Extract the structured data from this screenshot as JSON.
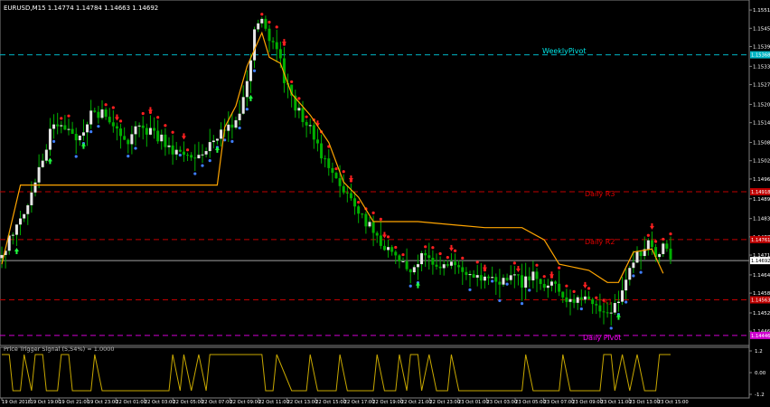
{
  "chart_data": [
    {
      "type": "candlestick",
      "title": "EURUSD,M15 1.14774 1.14784 1.14663 1.14692",
      "symbol": "EURUSD",
      "timeframe": "M15",
      "ohlc_header": {
        "open": 1.14774,
        "high": 1.14784,
        "low": 1.14663,
        "close": 1.14692
      },
      "y_axis": {
        "ticks": [
          1.15515,
          1.15455,
          1.15395,
          1.1533,
          1.1527,
          1.15205,
          1.15145,
          1.1508,
          1.1502,
          1.1496,
          1.14895,
          1.1483,
          1.1477,
          1.1471,
          1.14645,
          1.14585,
          1.1452,
          1.1446
        ],
        "ylim": [
          1.14413,
          1.15548
        ],
        "current_price_label": "1.14692",
        "current_price": 1.14692
      },
      "levels": [
        {
          "name": "WeeklyPivot",
          "label": "WeeklyPivot",
          "value": 1.15368,
          "price_label": "1.15368",
          "color": "#00b5c4",
          "label_color": "#00e5e5"
        },
        {
          "name": "Daily R3",
          "label": "Daily R3",
          "value": 1.14918,
          "price_label": "1.14918",
          "color": "#c00000",
          "label_color": "#e00000"
        },
        {
          "name": "Daily R2",
          "label": "Daily R2",
          "value": 1.14761,
          "price_label": "1.14761",
          "color": "#c00000",
          "label_color": "#e00000"
        },
        {
          "name": "Daily R1",
          "label": "R1",
          "value": 1.14563,
          "price_label": "1.14563",
          "color": "#c00000",
          "label_color": "#e00000"
        },
        {
          "name": "Daily Pivot",
          "label": "Daily Pivot",
          "value": 1.14446,
          "price_label": "1.14446",
          "color": "#d000d0",
          "label_color": "#ff00ff"
        }
      ],
      "x_axis": {
        "ticks": [
          "19 Oct 2018",
          "19 Oct 19:00",
          "19 Oct 21:00",
          "19 Oct 23:00",
          "22 Oct 01:00",
          "22 Oct 03:00",
          "22 Oct 05:00",
          "22 Oct 07:00",
          "22 Oct 09:00",
          "22 Oct 11:00",
          "22 Oct 13:00",
          "22 Oct 15:00",
          "22 Oct 17:00",
          "22 Oct 19:00",
          "22 Oct 21:00",
          "22 Oct 23:00",
          "23 Oct 01:00",
          "23 Oct 03:00",
          "23 Oct 05:00",
          "23 Oct 07:00",
          "23 Oct 09:00",
          "23 Oct 11:00",
          "23 Oct 13:00",
          "23 Oct 15:00"
        ]
      },
      "close_path": [
        [
          0,
          1.147
        ],
        [
          3,
          1.1479
        ],
        [
          6,
          1.1485
        ],
        [
          8,
          1.1492
        ],
        [
          10,
          1.1499
        ],
        [
          13,
          1.1511
        ],
        [
          16,
          1.1515
        ],
        [
          20,
          1.1508
        ],
        [
          24,
          1.1517
        ],
        [
          28,
          1.1518
        ],
        [
          31,
          1.1512
        ],
        [
          34,
          1.1507
        ],
        [
          37,
          1.1514
        ],
        [
          40,
          1.1511
        ],
        [
          43,
          1.1509
        ],
        [
          46,
          1.1504
        ],
        [
          49,
          1.1505
        ],
        [
          52,
          1.1502
        ],
        [
          55,
          1.1506
        ],
        [
          58,
          1.151
        ],
        [
          61,
          1.1513
        ],
        [
          64,
          1.1516
        ],
        [
          66,
          1.1527
        ],
        [
          68,
          1.1544
        ],
        [
          70,
          1.1547
        ],
        [
          72,
          1.1543
        ],
        [
          74,
          1.154
        ],
        [
          76,
          1.1529
        ],
        [
          78,
          1.1522
        ],
        [
          80,
          1.1518
        ],
        [
          83,
          1.1512
        ],
        [
          86,
          1.1504
        ],
        [
          89,
          1.1498
        ],
        [
          92,
          1.1492
        ],
        [
          95,
          1.1487
        ],
        [
          98,
          1.1482
        ],
        [
          101,
          1.1477
        ],
        [
          104,
          1.1472
        ],
        [
          107,
          1.1468
        ],
        [
          110,
          1.1466
        ],
        [
          113,
          1.1471
        ],
        [
          116,
          1.1469
        ],
        [
          119,
          1.1468
        ],
        [
          122,
          1.1467
        ],
        [
          125,
          1.1465
        ],
        [
          128,
          1.1465
        ],
        [
          131,
          1.1463
        ],
        [
          134,
          1.1463
        ],
        [
          137,
          1.1464
        ],
        [
          140,
          1.1462
        ],
        [
          143,
          1.1464
        ],
        [
          146,
          1.1462
        ],
        [
          149,
          1.146
        ],
        [
          152,
          1.1457
        ],
        [
          155,
          1.1456
        ],
        [
          158,
          1.1456
        ],
        [
          161,
          1.1454
        ],
        [
          164,
          1.1452
        ],
        [
          166,
          1.1456
        ],
        [
          168,
          1.1464
        ],
        [
          170,
          1.1469
        ],
        [
          172,
          1.1472
        ],
        [
          174,
          1.1476
        ],
        [
          176,
          1.147
        ],
        [
          178,
          1.1474
        ],
        [
          180,
          1.14692
        ]
      ],
      "orange_line_path": [
        [
          0,
          1.1468
        ],
        [
          5,
          1.1494
        ],
        [
          30,
          1.1494
        ],
        [
          58,
          1.1494
        ],
        [
          60,
          1.1513
        ],
        [
          63,
          1.152
        ],
        [
          66,
          1.1533
        ],
        [
          70,
          1.1544
        ],
        [
          72,
          1.1536
        ],
        [
          75,
          1.1534
        ],
        [
          78,
          1.1524
        ],
        [
          83,
          1.1517
        ],
        [
          88,
          1.1508
        ],
        [
          92,
          1.1495
        ],
        [
          96,
          1.149
        ],
        [
          100,
          1.1482
        ],
        [
          112,
          1.1482
        ],
        [
          130,
          1.148
        ],
        [
          140,
          1.148
        ],
        [
          146,
          1.1476
        ],
        [
          150,
          1.1468
        ],
        [
          158,
          1.1466
        ],
        [
          163,
          1.1462
        ],
        [
          166,
          1.1462
        ],
        [
          170,
          1.1472
        ],
        [
          175,
          1.1473
        ],
        [
          178,
          1.1465
        ]
      ]
    },
    {
      "type": "line",
      "title": "Price Trigger Signal (5,54%) = 1.0000",
      "y_axis": {
        "ticks": [
          "1.2",
          "0.00",
          "-1.2"
        ],
        "ylim": [
          -1.2,
          1.2
        ]
      },
      "color": "#c8a800",
      "series": [
        {
          "name": "Price Trigger Signal",
          "segments": [
            [
              0,
              1
            ],
            [
              2,
              1
            ],
            [
              3,
              -1
            ],
            [
              5,
              -1
            ],
            [
              6,
              1
            ],
            [
              8,
              -1
            ],
            [
              9,
              1
            ],
            [
              11,
              1
            ],
            [
              12,
              -1
            ],
            [
              15,
              -1
            ],
            [
              16,
              1
            ],
            [
              18,
              1
            ],
            [
              19,
              -1
            ],
            [
              24,
              -1
            ],
            [
              25,
              1
            ],
            [
              27,
              -1
            ],
            [
              45,
              -1
            ],
            [
              46,
              1
            ],
            [
              48,
              -1
            ],
            [
              49,
              1
            ],
            [
              51,
              -1
            ],
            [
              53,
              1
            ],
            [
              55,
              -1
            ],
            [
              56,
              1
            ],
            [
              70,
              1
            ],
            [
              71,
              -1
            ],
            [
              73,
              -1
            ],
            [
              74,
              1
            ],
            [
              78,
              -1
            ],
            [
              82,
              -1
            ],
            [
              83,
              1
            ],
            [
              85,
              -1
            ],
            [
              90,
              -1
            ],
            [
              91,
              1
            ],
            [
              93,
              -1
            ],
            [
              100,
              -1
            ],
            [
              101,
              1
            ],
            [
              103,
              -1
            ],
            [
              106,
              -1
            ],
            [
              107,
              1
            ],
            [
              109,
              -1
            ],
            [
              110,
              1
            ],
            [
              112,
              1
            ],
            [
              113,
              -1
            ],
            [
              115,
              1
            ],
            [
              117,
              -1
            ],
            [
              120,
              -1
            ],
            [
              121,
              1
            ],
            [
              123,
              -1
            ],
            [
              140,
              -1
            ],
            [
              141,
              1
            ],
            [
              143,
              -1
            ],
            [
              150,
              -1
            ],
            [
              151,
              1
            ],
            [
              153,
              -1
            ],
            [
              161,
              -1
            ],
            [
              162,
              1
            ],
            [
              164,
              1
            ],
            [
              165,
              -1
            ],
            [
              167,
              1
            ],
            [
              169,
              -1
            ],
            [
              171,
              1
            ],
            [
              173,
              -1
            ],
            [
              176,
              -1
            ],
            [
              177,
              1
            ],
            [
              180,
              1
            ]
          ]
        }
      ]
    }
  ]
}
